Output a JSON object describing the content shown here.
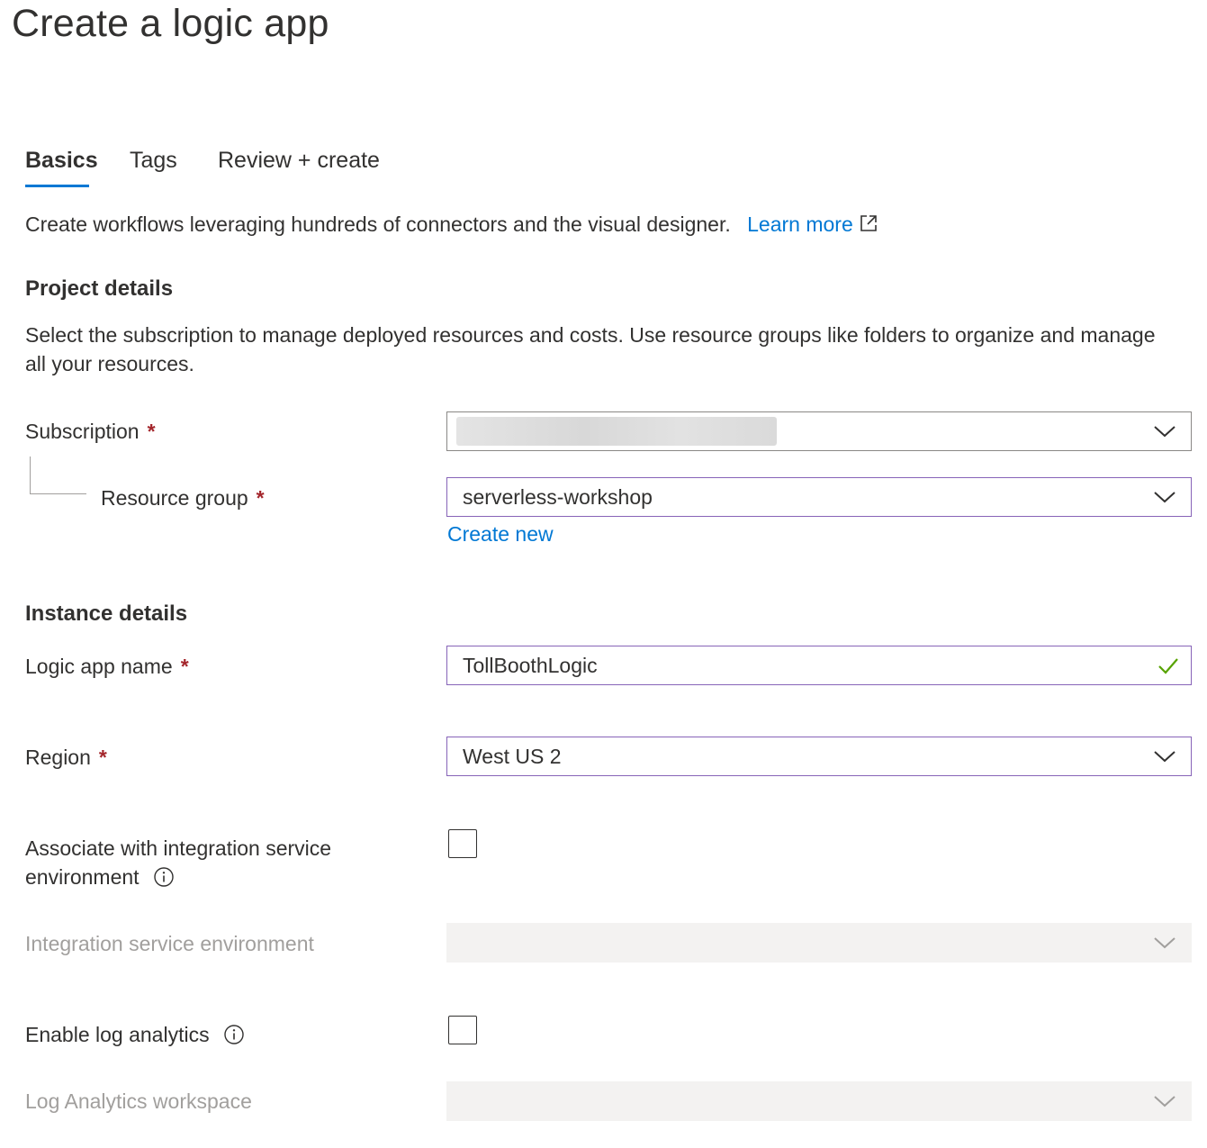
{
  "page": {
    "title": "Create a logic app"
  },
  "tabs": [
    {
      "label": "Basics",
      "active": true
    },
    {
      "label": "Tags",
      "active": false
    },
    {
      "label": "Review + create",
      "active": false
    }
  ],
  "intro": {
    "text": "Create workflows leveraging hundreds of connectors and the visual designer.",
    "learn_more": "Learn more"
  },
  "project_details": {
    "heading": "Project details",
    "description": "Select the subscription to manage deployed resources and costs. Use resource groups like folders to organize and manage all your resources.",
    "subscription": {
      "label": "Subscription",
      "required": "*",
      "value": ""
    },
    "resource_group": {
      "label": "Resource group",
      "required": "*",
      "value": "serverless-workshop",
      "create_new": "Create new"
    }
  },
  "instance_details": {
    "heading": "Instance details",
    "logic_app_name": {
      "label": "Logic app name",
      "required": "*",
      "value": "TollBoothLogic",
      "valid": true
    },
    "region": {
      "label": "Region",
      "required": "*",
      "value": "West US 2"
    },
    "associate_ise": {
      "label_line1": "Associate with integration service",
      "label_line2": "environment",
      "checked": false
    },
    "integration_service_environment": {
      "label": "Integration service environment",
      "value": "",
      "disabled": true
    },
    "enable_log_analytics": {
      "label": "Enable log analytics",
      "checked": false
    },
    "log_analytics_workspace": {
      "label": "Log Analytics workspace",
      "value": "",
      "disabled": true
    }
  },
  "colors": {
    "accent": "#0078d4",
    "focus_border": "#8764b8",
    "required": "#a4262c",
    "valid_check": "#57a300",
    "disabled_bg": "#f3f2f1",
    "disabled_text": "#a19f9d"
  },
  "icons": {
    "external_link": "external-link-icon",
    "chevron": "chevron-down-icon",
    "check": "checkmark-icon",
    "info": "info-icon"
  }
}
